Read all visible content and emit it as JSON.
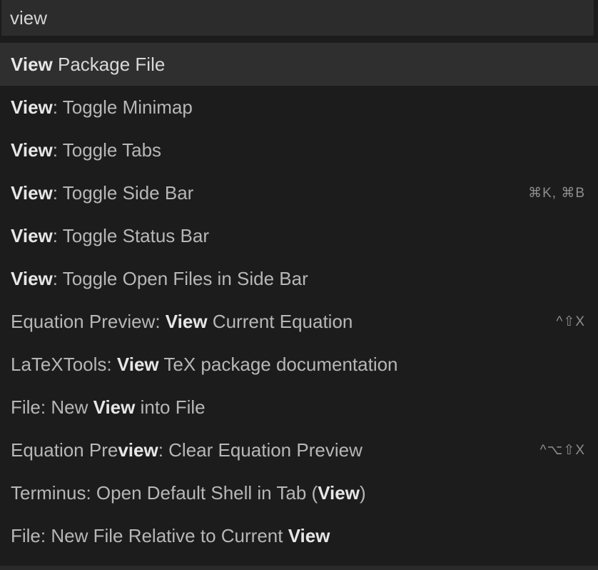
{
  "search": {
    "value": "view",
    "placeholder": ""
  },
  "items": [
    {
      "before": "",
      "match": "View",
      "after": " Package File",
      "shortcut": "",
      "selected": true
    },
    {
      "before": "",
      "match": "View",
      "after": ": Toggle Minimap",
      "shortcut": ""
    },
    {
      "before": "",
      "match": "View",
      "after": ": Toggle Tabs",
      "shortcut": ""
    },
    {
      "before": "",
      "match": "View",
      "after": ": Toggle Side Bar",
      "shortcut": "⌘K, ⌘B"
    },
    {
      "before": "",
      "match": "View",
      "after": ": Toggle Status Bar",
      "shortcut": ""
    },
    {
      "before": "",
      "match": "View",
      "after": ": Toggle Open Files in Side Bar",
      "shortcut": ""
    },
    {
      "before": "Equation Preview: ",
      "match": "View",
      "after": " Current Equation",
      "shortcut": "^⇧X"
    },
    {
      "before": "LaTeXTools: ",
      "match": "View",
      "after": " TeX package documentation",
      "shortcut": ""
    },
    {
      "before": "File: New ",
      "match": "View",
      "after": " into File",
      "shortcut": ""
    },
    {
      "before": "Equation Pre",
      "match": "view",
      "after": ": Clear Equation Preview",
      "shortcut": "^⌥⇧X"
    },
    {
      "before": "Terminus: Open Default Shell in Tab (",
      "match": "View",
      "after": ")",
      "shortcut": ""
    },
    {
      "before": "File: New File Relative to Current ",
      "match": "View",
      "after": "",
      "shortcut": ""
    }
  ]
}
